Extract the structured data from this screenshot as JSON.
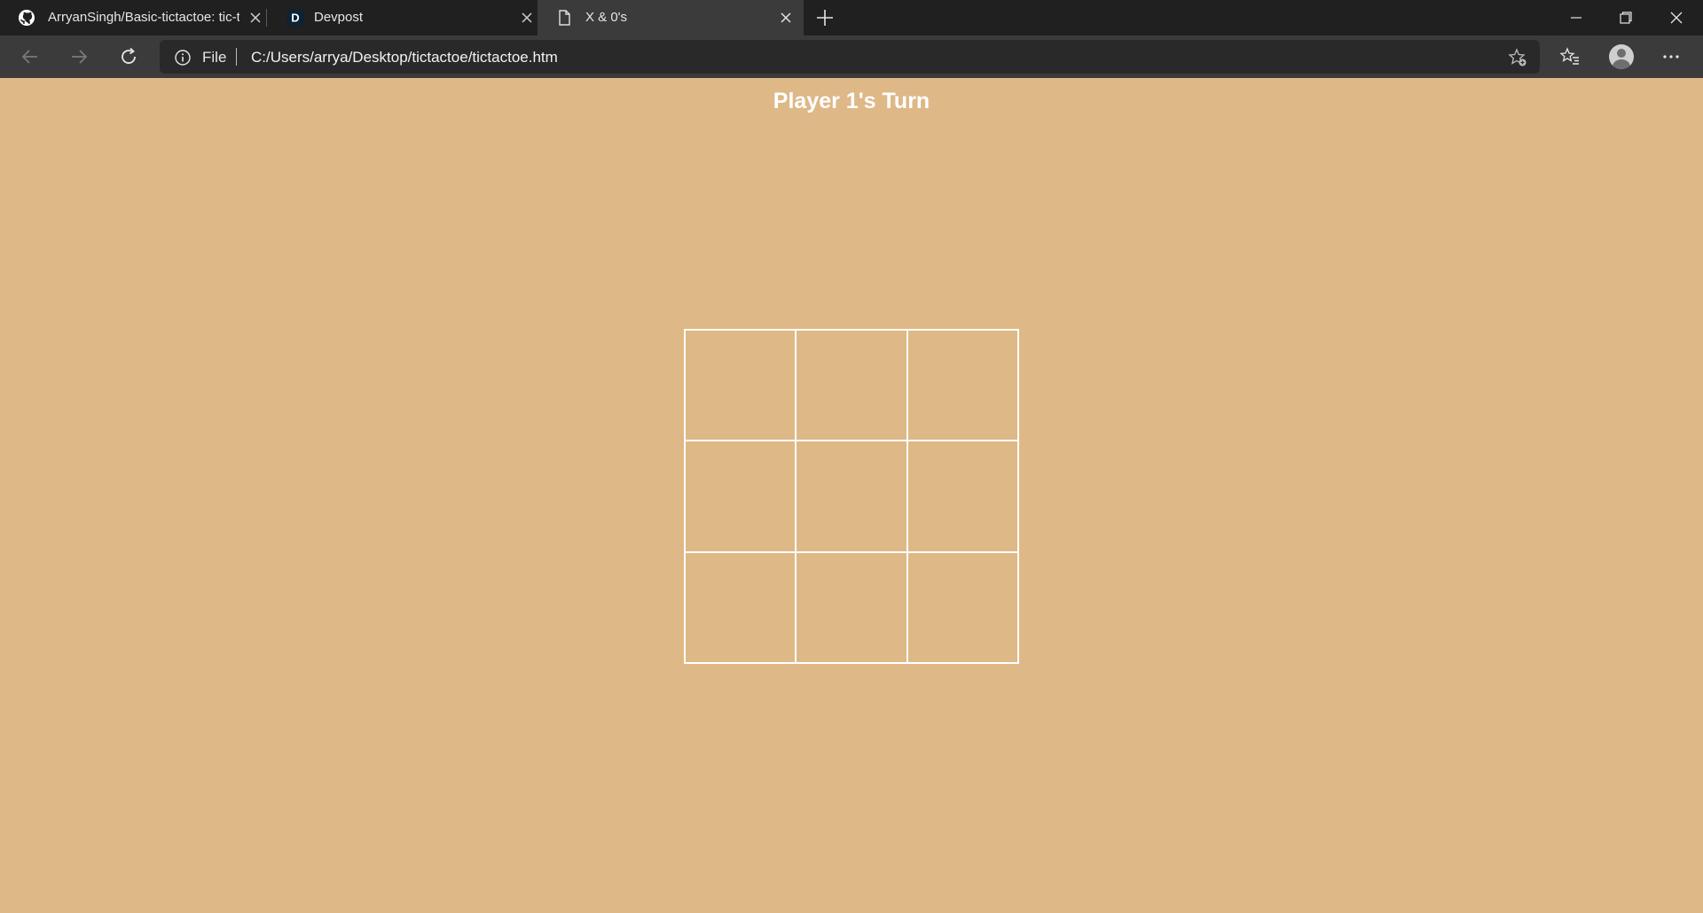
{
  "browser": {
    "tabs": [
      {
        "title": "ArryanSingh/Basic-tictactoe: tic-t",
        "favicon": "github-icon"
      },
      {
        "title": "Devpost",
        "favicon": "devpost-icon",
        "favicon_letter": "D"
      },
      {
        "title": "X & 0's",
        "favicon": "page-icon",
        "active": true
      }
    ],
    "address": {
      "scheme_label": "File",
      "url": "C:/Users/arrya/Desktop/tictactoe/tictactoe.htm"
    }
  },
  "game": {
    "status": "Player 1's Turn",
    "board": [
      "",
      "",
      "",
      "",
      "",
      "",
      "",
      "",
      ""
    ]
  },
  "colors": {
    "page_background": "#deb887",
    "board_lines": "#ffffff",
    "tabstrip": "#202020",
    "toolbar": "#3b3b3b"
  }
}
